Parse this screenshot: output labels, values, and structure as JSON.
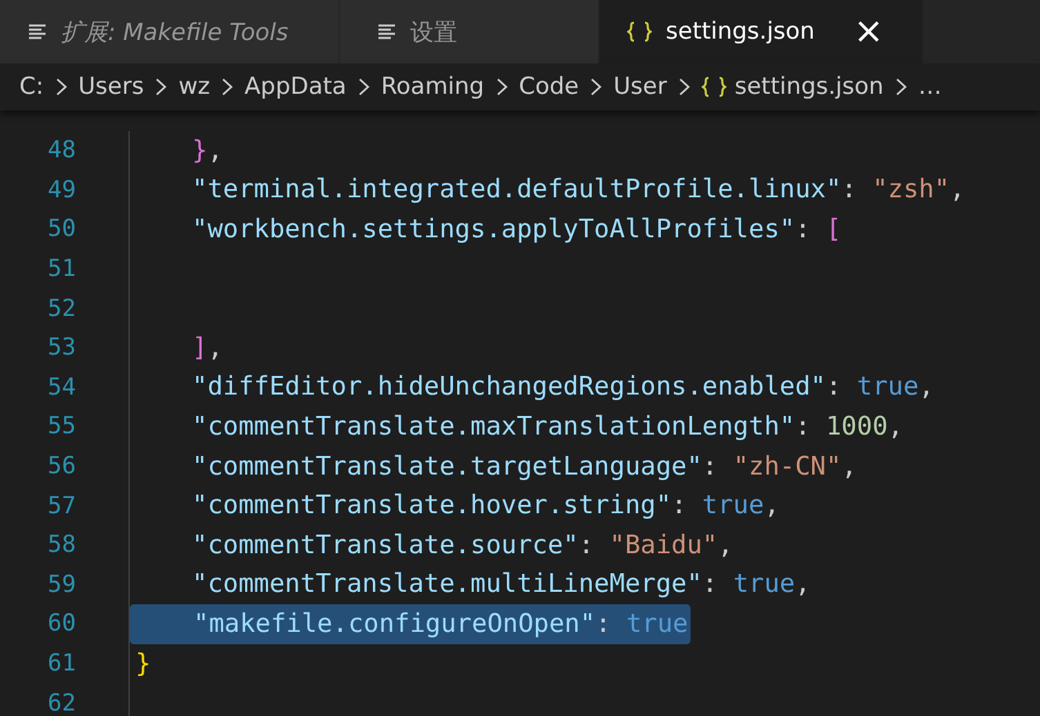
{
  "tabs": [
    {
      "label": "扩展: Makefile Tools",
      "kind": "settings",
      "preview": true,
      "selected": false
    },
    {
      "label": "设置",
      "kind": "settings",
      "preview": false,
      "selected": false
    },
    {
      "label": "settings.json",
      "kind": "json",
      "preview": false,
      "selected": true,
      "close_glyph": "×"
    }
  ],
  "breadcrumbs": [
    {
      "label": "C:",
      "kind": "folder"
    },
    {
      "label": "Users",
      "kind": "folder"
    },
    {
      "label": "wz",
      "kind": "folder"
    },
    {
      "label": "AppData",
      "kind": "folder"
    },
    {
      "label": "Roaming",
      "kind": "folder"
    },
    {
      "label": "Code",
      "kind": "folder"
    },
    {
      "label": "User",
      "kind": "folder"
    },
    {
      "label": "settings.json",
      "kind": "json"
    },
    {
      "label": "…",
      "kind": "symbol"
    }
  ],
  "lines": [
    {
      "number": "48",
      "indented": true,
      "selected": false,
      "tokens": [
        {
          "kind": "bracket",
          "text": "}"
        },
        {
          "kind": "punct",
          "text": ","
        }
      ]
    },
    {
      "number": "49",
      "indented": true,
      "selected": false,
      "tokens": [
        {
          "kind": "key",
          "text": "\"terminal.integrated.defaultProfile.linux\""
        },
        {
          "kind": "punct",
          "text": ": "
        },
        {
          "kind": "string",
          "text": "\"zsh\""
        },
        {
          "kind": "punct",
          "text": ","
        }
      ]
    },
    {
      "number": "50",
      "indented": true,
      "selected": false,
      "tokens": [
        {
          "kind": "key",
          "text": "\"workbench.settings.applyToAllProfiles\""
        },
        {
          "kind": "punct",
          "text": ": "
        },
        {
          "kind": "bracket",
          "text": "["
        }
      ]
    },
    {
      "number": "51",
      "selected": false
    },
    {
      "number": "52",
      "selected": false
    },
    {
      "number": "53",
      "indented": true,
      "selected": false,
      "tokens": [
        {
          "kind": "bracket",
          "text": "]"
        },
        {
          "kind": "punct",
          "text": ","
        }
      ]
    },
    {
      "number": "54",
      "indented": true,
      "selected": false,
      "tokens": [
        {
          "kind": "key",
          "text": "\"diffEditor.hideUnchangedRegions.enabled\""
        },
        {
          "kind": "punct",
          "text": ": "
        },
        {
          "kind": "keyword",
          "text": "true"
        },
        {
          "kind": "punct",
          "text": ","
        }
      ]
    },
    {
      "number": "55",
      "indented": true,
      "selected": false,
      "tokens": [
        {
          "kind": "key",
          "text": "\"commentTranslate.maxTranslationLength\""
        },
        {
          "kind": "punct",
          "text": ": "
        },
        {
          "kind": "number",
          "text": "1000"
        },
        {
          "kind": "punct",
          "text": ","
        }
      ]
    },
    {
      "number": "56",
      "indented": true,
      "selected": false,
      "tokens": [
        {
          "kind": "key",
          "text": "\"commentTranslate.targetLanguage\""
        },
        {
          "kind": "punct",
          "text": ": "
        },
        {
          "kind": "string",
          "text": "\"zh-CN\""
        },
        {
          "kind": "punct",
          "text": ","
        }
      ]
    },
    {
      "number": "57",
      "indented": true,
      "selected": false,
      "tokens": [
        {
          "kind": "key",
          "text": "\"commentTranslate.hover.string\""
        },
        {
          "kind": "punct",
          "text": ": "
        },
        {
          "kind": "keyword",
          "text": "true"
        },
        {
          "kind": "punct",
          "text": ","
        }
      ]
    },
    {
      "number": "58",
      "indented": true,
      "selected": false,
      "tokens": [
        {
          "kind": "key",
          "text": "\"commentTranslate.source\""
        },
        {
          "kind": "punct",
          "text": ": "
        },
        {
          "kind": "string",
          "text": "\"Baidu\""
        },
        {
          "kind": "punct",
          "text": ","
        }
      ]
    },
    {
      "number": "59",
      "indented": true,
      "selected": false,
      "tokens": [
        {
          "kind": "key",
          "text": "\"commentTranslate.multiLineMerge\""
        },
        {
          "kind": "punct",
          "text": ": "
        },
        {
          "kind": "keyword",
          "text": "true"
        },
        {
          "kind": "punct",
          "text": ","
        }
      ]
    },
    {
      "number": "60",
      "indented": true,
      "selected": true,
      "tokens": [
        {
          "kind": "key",
          "text": "\"makefile.configureOnOpen\""
        },
        {
          "kind": "punct",
          "text": ": "
        },
        {
          "kind": "keyword",
          "text": "true"
        }
      ]
    },
    {
      "number": "61",
      "indented": false,
      "selected": false,
      "tokens": [
        {
          "kind": "rootbrace",
          "text": "}"
        }
      ]
    },
    {
      "number": "62",
      "selected": false
    }
  ]
}
